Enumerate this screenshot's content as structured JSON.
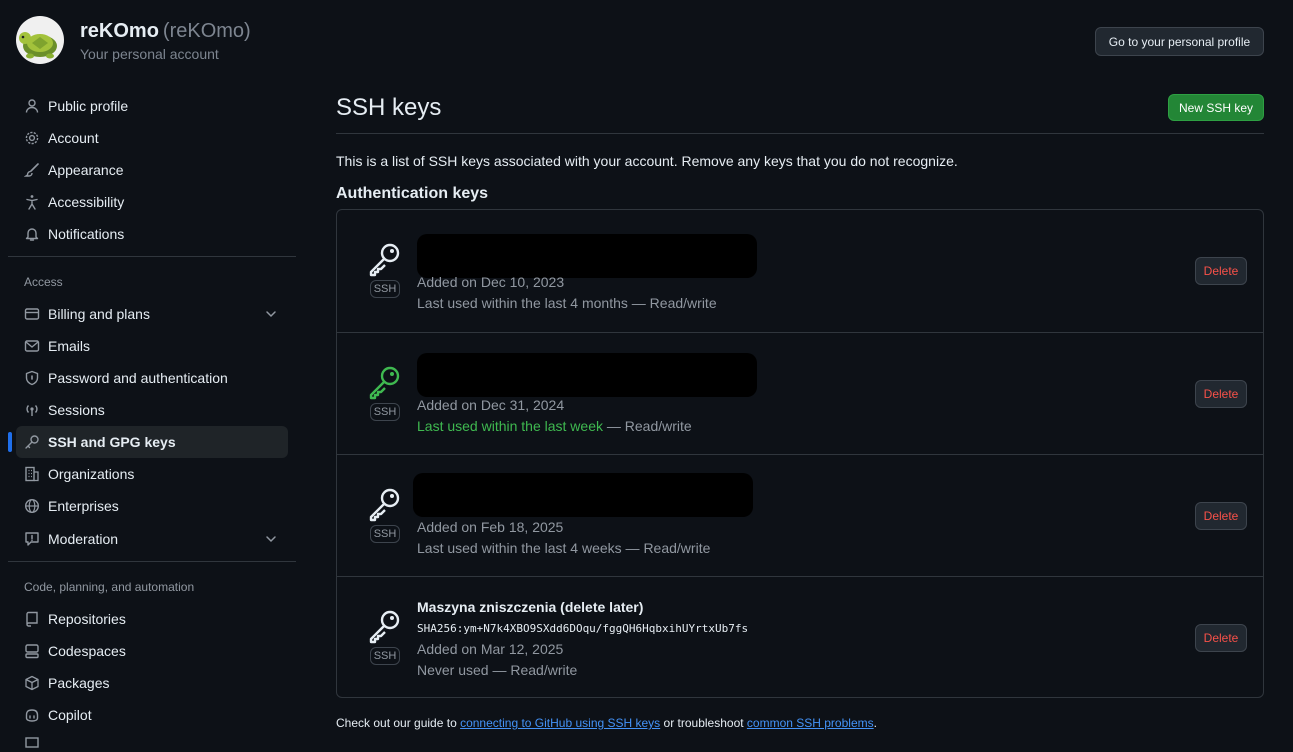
{
  "account": {
    "name": "reKOmo",
    "login": "(reKOmo)",
    "subtitle": "Your personal account",
    "profile_button": "Go to your personal profile"
  },
  "sidebar": {
    "items_top": [
      {
        "label": "Public profile",
        "icon": "person-icon"
      },
      {
        "label": "Account",
        "icon": "gear-icon"
      },
      {
        "label": "Appearance",
        "icon": "paintbrush-icon"
      },
      {
        "label": "Accessibility",
        "icon": "accessibility-icon"
      },
      {
        "label": "Notifications",
        "icon": "bell-icon"
      }
    ],
    "access_title": "Access",
    "items_access": [
      {
        "label": "Billing and plans",
        "icon": "credit-card-icon",
        "expandable": true
      },
      {
        "label": "Emails",
        "icon": "mail-icon"
      },
      {
        "label": "Password and authentication",
        "icon": "shield-lock-icon"
      },
      {
        "label": "Sessions",
        "icon": "broadcast-icon"
      },
      {
        "label": "SSH and GPG keys",
        "icon": "key-icon",
        "active": true
      },
      {
        "label": "Organizations",
        "icon": "organization-icon"
      },
      {
        "label": "Enterprises",
        "icon": "globe-icon"
      },
      {
        "label": "Moderation",
        "icon": "report-icon",
        "expandable": true
      }
    ],
    "code_title": "Code, planning, and automation",
    "items_code": [
      {
        "label": "Repositories",
        "icon": "repo-icon"
      },
      {
        "label": "Codespaces",
        "icon": "codespaces-icon"
      },
      {
        "label": "Packages",
        "icon": "package-icon"
      },
      {
        "label": "Copilot",
        "icon": "copilot-icon"
      }
    ]
  },
  "main": {
    "title": "SSH keys",
    "new_button": "New SSH key",
    "intro": "This is a list of SSH keys associated with your account. Remove any keys that you do not recognize.",
    "auth_title": "Authentication keys",
    "keys": [
      {
        "title": "",
        "fingerprint": "",
        "added": "Added on Dec 10, 2023",
        "used": "Last used within the last 4 months",
        "used_suffix": " — Read/write",
        "recent": false,
        "badge": "SSH",
        "delete": "Delete"
      },
      {
        "title": "",
        "fingerprint": "",
        "added": "Added on Dec 31, 2024",
        "used": "Last used within the last week",
        "used_suffix": " — Read/write",
        "recent": true,
        "badge": "SSH",
        "delete": "Delete"
      },
      {
        "title": "",
        "fingerprint": "",
        "added": "Added on Feb 18, 2025",
        "used": "Last used within the last 4 weeks",
        "used_suffix": " — Read/write",
        "recent": false,
        "badge": "SSH",
        "delete": "Delete"
      },
      {
        "title": "Maszyna zniszczenia (delete later)",
        "fingerprint": "SHA256:ym+N7k4XBO9SXdd6DOqu/fggQH6HqbxihUYrtxUb7fs",
        "added": "Added on Mar 12, 2025",
        "used": "Never used",
        "used_suffix": " — Read/write",
        "recent": false,
        "badge": "SSH",
        "delete": "Delete"
      }
    ],
    "footer": {
      "prefix": "Check out our guide to ",
      "link1": "connecting to GitHub using SSH keys",
      "middle": " or troubleshoot ",
      "link2": "common SSH problems",
      "suffix": "."
    }
  },
  "colors": {
    "background": "#0d1117",
    "accent_blue": "#1f6feb",
    "link_blue": "#4493f8",
    "success_green": "#238636",
    "recent_green": "#3fb950",
    "danger_red": "#f85149"
  }
}
